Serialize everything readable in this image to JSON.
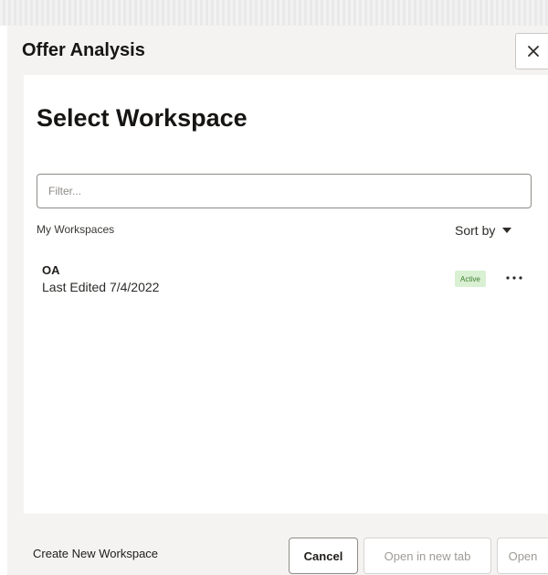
{
  "dialog": {
    "title": "Offer Analysis",
    "close_icon": "close-icon"
  },
  "panel": {
    "heading": "Select Workspace",
    "filter": {
      "placeholder": "Filter...",
      "value": ""
    },
    "section_label": "My Workspaces",
    "sort_label": "Sort by",
    "sort_icon": "caret-down-icon",
    "workspaces": [
      {
        "name": "OA",
        "last_edited": "Last Edited 7/4/2022",
        "status": "Active",
        "status_color": "#d9f0d2",
        "menu_icon": "more-horizontal-icon"
      }
    ]
  },
  "footer": {
    "create_label": "Create New Workspace",
    "cancel_label": "Cancel",
    "open_new_tab_label": "Open in new tab",
    "open_label": "Open"
  }
}
